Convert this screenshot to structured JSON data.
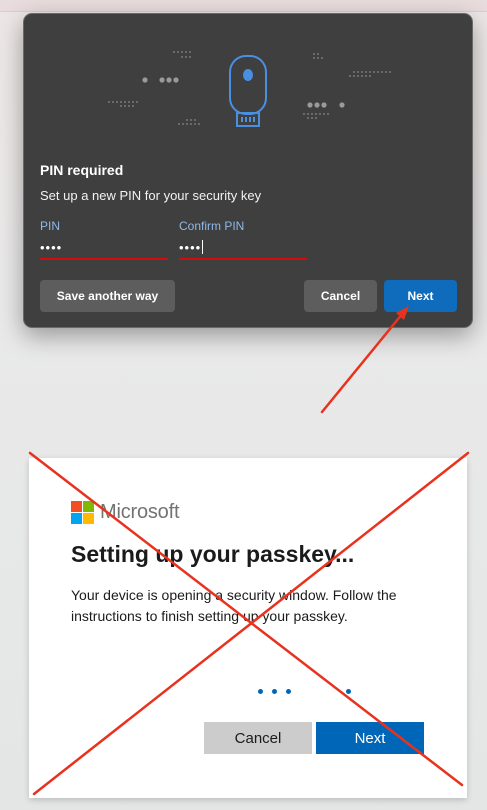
{
  "security_dialog": {
    "title": "PIN required",
    "subtitle": "Set up a new PIN for your security key",
    "pin_label": "PIN",
    "pin_value": "••••",
    "confirm_label": "Confirm PIN",
    "confirm_value": "••••",
    "save_another_way_label": "Save another way",
    "cancel_label": "Cancel",
    "next_label": "Next",
    "icon": "usb-security-key-icon",
    "colors": {
      "background": "#3f3f3f",
      "accent": "#0f6cbd",
      "field_underline": "#d10d0d",
      "label": "#8fb8e8"
    }
  },
  "microsoft_page": {
    "brand": "Microsoft",
    "title": "Setting up your passkey...",
    "description": "Your device is opening a security window. Follow the instructions to finish setting up your passkey.",
    "cancel_label": "Cancel",
    "next_label": "Next",
    "colors": {
      "accent": "#0067b8",
      "logo": [
        "#f25022",
        "#7fba00",
        "#00a4ef",
        "#ffb900"
      ]
    }
  },
  "annotations": {
    "color": "#e8321e",
    "arrow": "points-to-next-button",
    "cross": "red-x-over-microsoft-page"
  }
}
